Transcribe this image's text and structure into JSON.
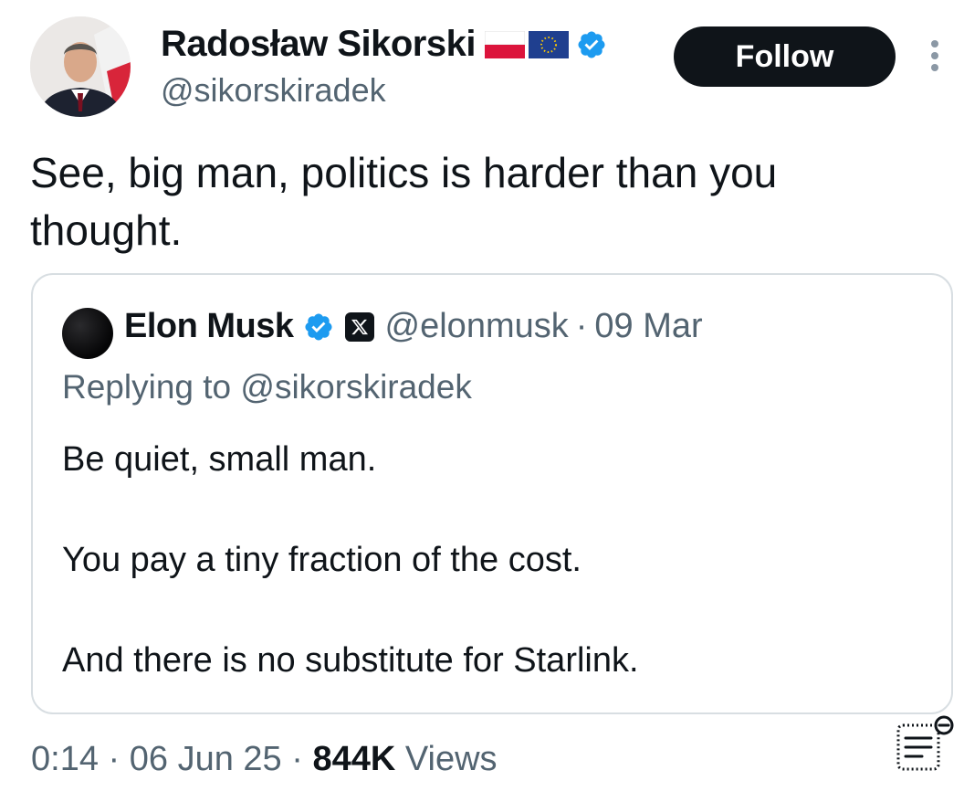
{
  "author": {
    "name": "Radosław Sikorski",
    "handle": "@sikorskiradek"
  },
  "follow_label": "Follow",
  "tweet_text": "See, big man, politics is harder than you thought.",
  "quote": {
    "name": "Elon Musk",
    "handle": "@elonmusk",
    "separator": "·",
    "date": "09 Mar",
    "replying_to": "Replying to @sikorskiradek",
    "lines": [
      "Be quiet, small man.",
      "You pay a tiny fraction of the cost.",
      "And there is no substitute for Starlink."
    ]
  },
  "meta": {
    "time": "0:14",
    "separator": "·",
    "date": "06 Jun 25",
    "views_count": "844K",
    "views_label": "Views"
  },
  "icons": {
    "verified": "verified-badge-icon",
    "x_affiliate": "x-logo-icon",
    "more": "more-vertical-icon",
    "analytics": "analytics-icon"
  },
  "colors": {
    "text": "#0f1419",
    "secondary": "#536471",
    "verified": "#1d9bf0",
    "follow_bg": "#0f1419"
  }
}
